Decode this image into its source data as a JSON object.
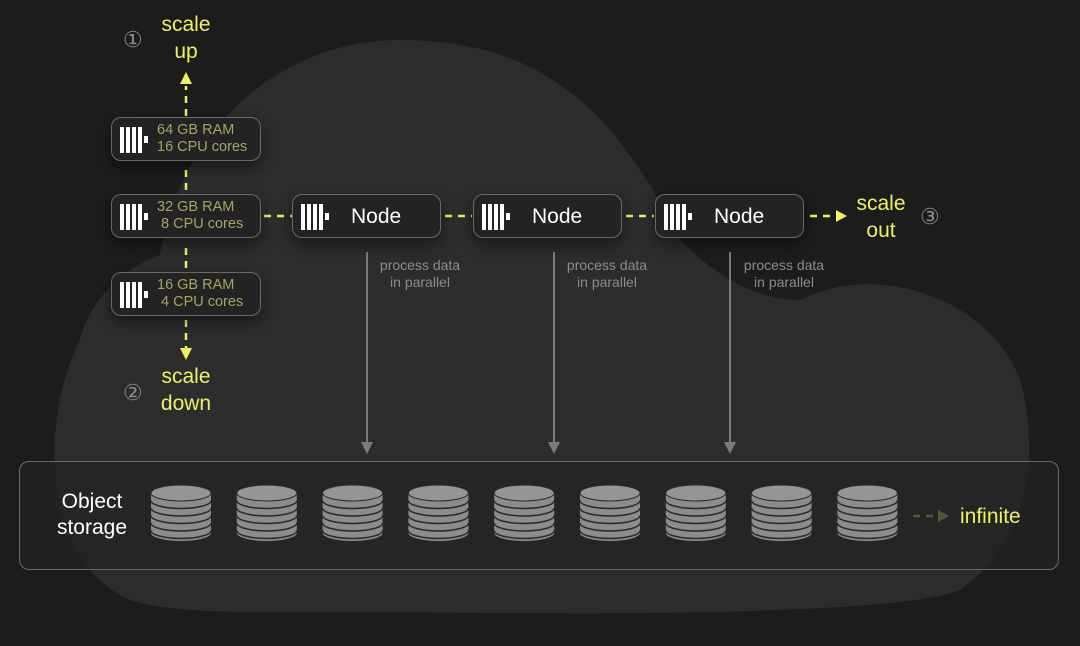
{
  "colors": {
    "accent": "#f0f060",
    "spec_text": "#a9a55e",
    "background": "#1c1c1c",
    "cloud": "#2c2c2c"
  },
  "scale_up": {
    "number": "①",
    "label_line1": "scale",
    "label_line2": "up"
  },
  "scale_down": {
    "number": "②",
    "label_line1": "scale",
    "label_line2": "down"
  },
  "scale_out": {
    "number": "③",
    "label_line1": "scale",
    "label_line2": "out"
  },
  "spec_boxes": [
    {
      "ram": "64 GB RAM",
      "cpu": "16 CPU cores",
      "icon": "clickhouse-logo-icon"
    },
    {
      "ram": "32 GB RAM",
      "cpu": "8 CPU cores",
      "icon": "clickhouse-logo-icon"
    },
    {
      "ram": "16 GB RAM",
      "cpu": "4 CPU cores",
      "icon": "clickhouse-logo-icon"
    }
  ],
  "nodes": [
    {
      "label": "Node",
      "note_line1": "process data",
      "note_line2": "in parallel"
    },
    {
      "label": "Node",
      "note_line1": "process data",
      "note_line2": "in parallel"
    },
    {
      "label": "Node",
      "note_line1": "process data",
      "note_line2": "in parallel"
    }
  ],
  "storage": {
    "label_line1": "Object",
    "label_line2": "storage",
    "disk_count": 9,
    "icon": "database-disk-icon",
    "suffix": "infinite"
  }
}
